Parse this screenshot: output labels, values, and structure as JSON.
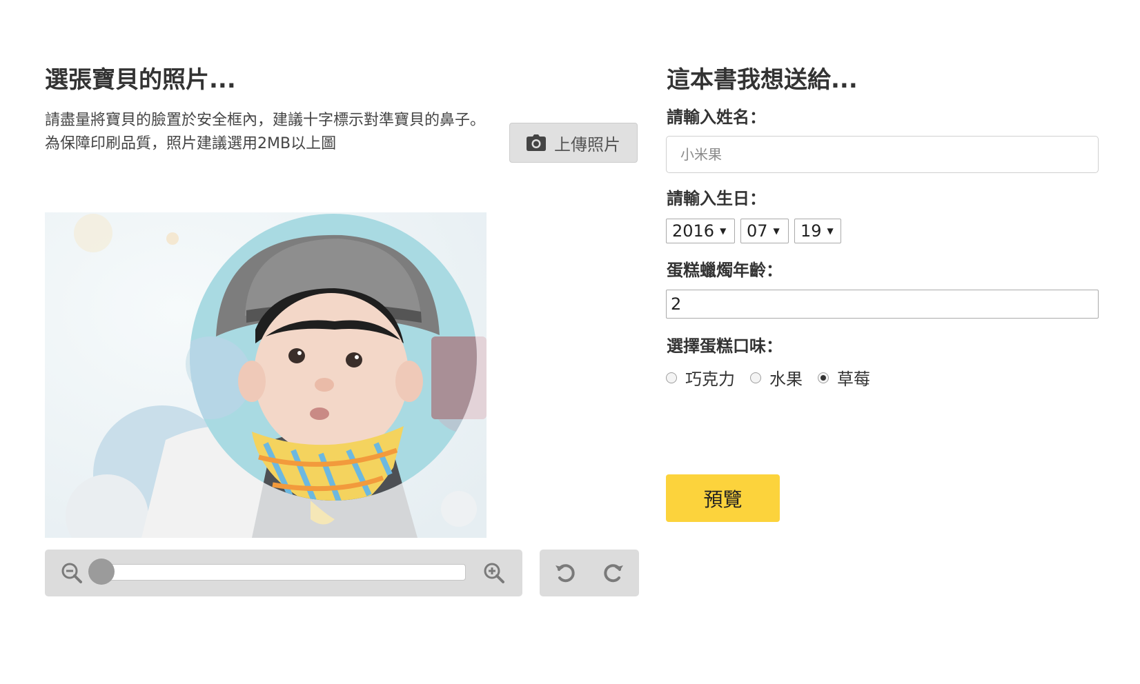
{
  "photo_panel": {
    "title": "選張寶貝的照片...",
    "hint_lines": [
      "請盡量將寶貝的臉置於安全框內，建議十字標示對準寶貝的鼻子。",
      "為保障印刷品質，照片建議選用2MB以上圖"
    ],
    "upload_button_label": "上傳照片",
    "upload_icon": "camera-icon",
    "zoom_level": 0,
    "zoom_out_icon": "zoom-out-icon",
    "zoom_in_icon": "zoom-in-icon",
    "rotate_left_icon": "rotate-left-icon",
    "rotate_right_icon": "rotate-right-icon"
  },
  "form": {
    "title": "這本書我想送給...",
    "name_label": "請輸入姓名：",
    "name_placeholder": "小米果",
    "name_value": "",
    "birthday_label": "請輸入生日：",
    "birthday": {
      "year": "2016",
      "month": "07",
      "day": "19"
    },
    "candle_label": "蛋糕蠟燭年齡：",
    "candle_value": "2",
    "flavor_label": "選擇蛋糕口味：",
    "flavors": [
      {
        "label": "巧克力",
        "checked": false
      },
      {
        "label": "水果",
        "checked": false
      },
      {
        "label": "草莓",
        "checked": true
      }
    ],
    "preview_button_label": "預覽"
  },
  "colors": {
    "preview_button": "#fcd33c",
    "control_bar": "#dcdcdc",
    "text": "#333333"
  }
}
